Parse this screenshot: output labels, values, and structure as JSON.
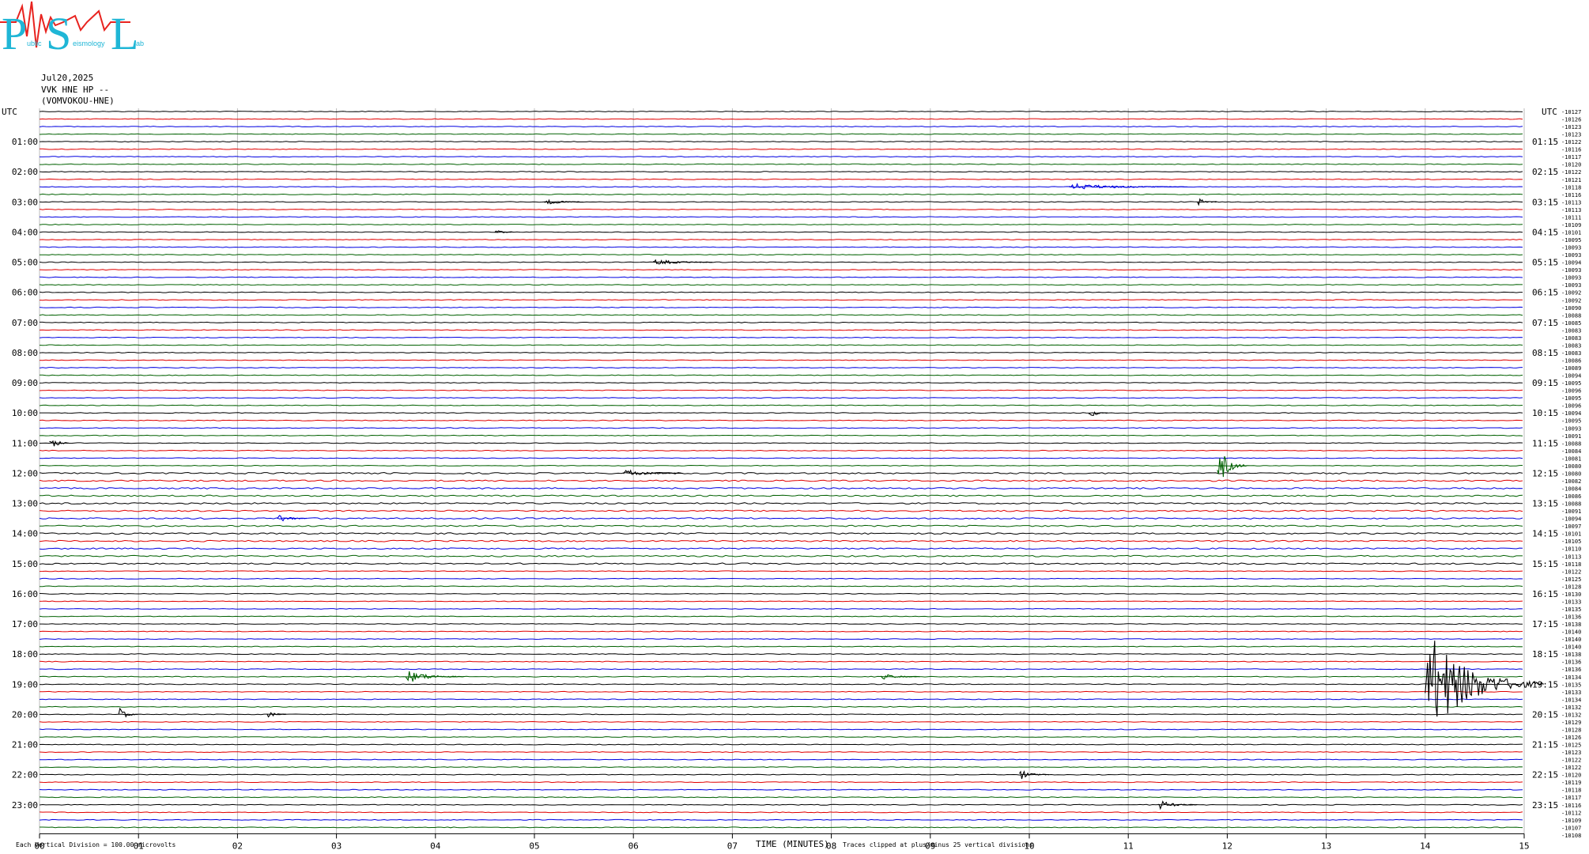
{
  "logo": {
    "big_letters": [
      "P",
      "S",
      "L"
    ],
    "small_text": [
      "ublic",
      "eismology",
      "ab"
    ],
    "accent_color": "#e8231f",
    "brand_color": "#1fb6d6"
  },
  "header": {
    "date": "Jul20,2025",
    "station": "VVK HNE HP --",
    "station_name": "(VOMVOKOU-HNE)"
  },
  "footer": {
    "left_note": "Each Vertical Division =  100.00 microvolts",
    "xlabel": "TIME (MINUTES)",
    "clip_note": "Traces clipped at plus/minus 25 vertical divisions"
  },
  "chart_data": {
    "type": "line",
    "title": "",
    "xlabel": "TIME (MINUTES)",
    "xlim": [
      0,
      15
    ],
    "x_ticks": [
      "00",
      "01",
      "02",
      "03",
      "04",
      "05",
      "06",
      "07",
      "08",
      "09",
      "10",
      "11",
      "12",
      "13",
      "14",
      "15"
    ],
    "left_axis_label": "UTC",
    "right_axis_label": "UTC",
    "left_hour_labels": [
      "01:00",
      "02:00",
      "03:00",
      "04:00",
      "05:00",
      "06:00",
      "07:00",
      "08:00",
      "09:00",
      "10:00",
      "11:00",
      "12:00",
      "13:00",
      "14:00",
      "15:00",
      "16:00",
      "17:00",
      "18:00",
      "19:00",
      "20:00",
      "21:00",
      "22:00",
      "23:00"
    ],
    "right_hour_labels": [
      "01:15",
      "02:15",
      "03:15",
      "04:15",
      "05:15",
      "06:15",
      "07:15",
      "08:15",
      "09:15",
      "10:15",
      "11:15",
      "12:15",
      "13:15",
      "14:15",
      "15:15",
      "16:15",
      "17:15",
      "18:15",
      "19:15",
      "20:15",
      "21:15",
      "22:15",
      "23:15"
    ],
    "trace_colors": [
      "#000000",
      "#e00000",
      "#0000e0",
      "#006000"
    ],
    "trace_count": 96,
    "minutes_per_trace": 15,
    "right_offsets": [
      "-10127",
      "-10126",
      "-10123",
      "-10123",
      "-10122",
      "-10116",
      "-10117",
      "-10120",
      "-10122",
      "-10121",
      "-10118",
      "-10116",
      "-10113",
      "-10113",
      "-10111",
      "-10109",
      "-10101",
      "-10095",
      "-10093",
      "-10093",
      "-10094",
      "-10093",
      "-10093",
      "-10093",
      "-10092",
      "-10092",
      "-10090",
      "-10088",
      "-10085",
      "-10083",
      "-10083",
      "-10083",
      "-10083",
      "-10086",
      "-10089",
      "-10094",
      "-10095",
      "-10096",
      "-10095",
      "-10096",
      "-10094",
      "-10095",
      "-10093",
      "-10091",
      "-10088",
      "-10084",
      "-10081",
      "-10080",
      "-10080",
      "-10082",
      "-10084",
      "-10086",
      "-10088",
      "-10091",
      "-10094",
      "-10097",
      "-10101",
      "-10105",
      "-10110",
      "-10113",
      "-10118",
      "-10122",
      "-10125",
      "-10128",
      "-10130",
      "-10133",
      "-10135",
      "-10136",
      "-10138",
      "-10140",
      "-10140",
      "-10140",
      "-10138",
      "-10136",
      "-10136",
      "-10134",
      "-10135",
      "-10133",
      "-10134",
      "-10132",
      "-10132",
      "-10129",
      "-10128",
      "-10126",
      "-10125",
      "-10123",
      "-10122",
      "-10122",
      "-10120",
      "-10119",
      "-10118",
      "-10117",
      "-10116",
      "-10112",
      "-10109",
      "-10107"
    ],
    "right_last_label": "-10108",
    "events": [
      {
        "trace": 10,
        "minute": 10.4,
        "amp": 0.5,
        "dur": 1.2
      },
      {
        "trace": 12,
        "minute": 5.1,
        "amp": 0.6,
        "dur": 0.4
      },
      {
        "trace": 12,
        "minute": 11.7,
        "amp": 0.7,
        "dur": 0.2
      },
      {
        "trace": 16,
        "minute": 4.6,
        "amp": 0.4,
        "dur": 0.2
      },
      {
        "trace": 20,
        "minute": 6.2,
        "amp": 0.5,
        "dur": 0.6
      },
      {
        "trace": 40,
        "minute": 10.6,
        "amp": 0.8,
        "dur": 0.2
      },
      {
        "trace": 44,
        "minute": 0.1,
        "amp": 1.2,
        "dur": 0.2
      },
      {
        "trace": 47,
        "minute": 11.9,
        "amp": 3.0,
        "dur": 0.3
      },
      {
        "trace": 48,
        "minute": 5.9,
        "amp": 0.6,
        "dur": 0.6
      },
      {
        "trace": 54,
        "minute": 2.4,
        "amp": 0.8,
        "dur": 0.3
      },
      {
        "trace": 75,
        "minute": 3.7,
        "amp": 1.0,
        "dur": 0.6
      },
      {
        "trace": 75,
        "minute": 8.5,
        "amp": 0.5,
        "dur": 0.4
      },
      {
        "trace": 76,
        "minute": 14.0,
        "amp": 8.0,
        "dur": 1.2
      },
      {
        "trace": 80,
        "minute": 0.8,
        "amp": 1.2,
        "dur": 0.2
      },
      {
        "trace": 80,
        "minute": 2.3,
        "amp": 0.6,
        "dur": 0.2
      },
      {
        "trace": 88,
        "minute": 9.9,
        "amp": 0.8,
        "dur": 0.3
      },
      {
        "trace": 92,
        "minute": 11.3,
        "amp": 0.7,
        "dur": 0.4
      }
    ]
  }
}
